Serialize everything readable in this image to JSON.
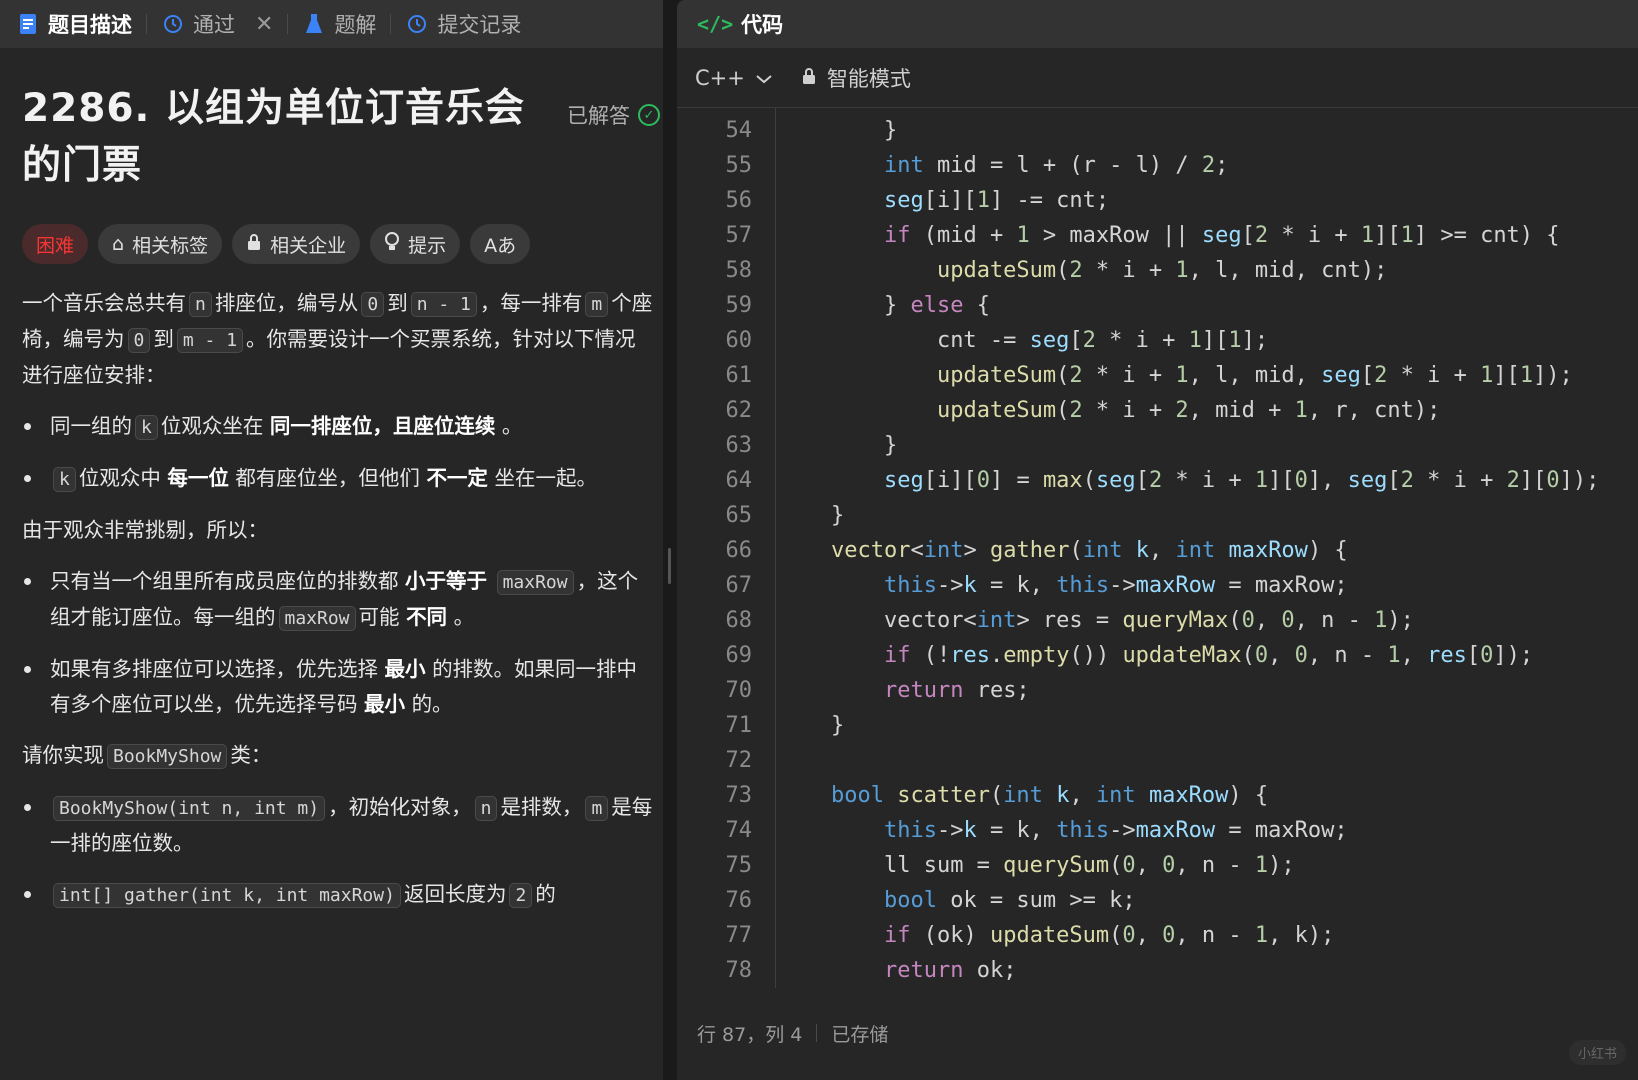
{
  "tabs": {
    "description": "题目描述",
    "passed": "通过",
    "solutions": "题解",
    "submissions": "提交记录"
  },
  "problem": {
    "title": "2286. 以组为单位订音乐会的门票",
    "solved_label": "已解答",
    "tags": {
      "difficulty": "困难",
      "related_tags": "相关标签",
      "related_companies": "相关企业",
      "hint": "提示",
      "font": "Aあ"
    }
  },
  "description": {
    "p1": [
      "一个音乐会总共有",
      "n",
      "排座位，编号从",
      "0",
      "到",
      "n - 1",
      "，每一排有",
      "m",
      "个座椅，编号为",
      "0",
      "到",
      "m - 1",
      "。你需要设计一个买票系统，针对以下情况进行座位安排："
    ],
    "b1": [
      "同一组的",
      "k",
      "位观众坐在",
      "同一排座位，且座位连续",
      "。"
    ],
    "b2": [
      "k",
      "位观众中",
      "每一位",
      "都有座位坐，但他们",
      "不一定",
      "坐在一起。"
    ],
    "p2": "由于观众非常挑剔，所以：",
    "b3": [
      "只有当一个组里所有成员座位的排数都",
      "小于等于",
      "maxRow",
      "，这个组才能订座位。每一组的",
      "maxRow",
      "可能",
      "不同",
      "。"
    ],
    "b4": [
      "如果有多排座位可以选择，优先选择",
      "最小",
      "的排数。如果同一排中有多个座位可以坐，优先选择号码",
      "最小",
      "的。"
    ],
    "p3": [
      "请你实现",
      "BookMyShow",
      "类："
    ],
    "b5": [
      "BookMyShow(int n, int m)",
      "，初始化对象，",
      "n",
      "是排数，",
      "m",
      "是每一排的座位数。"
    ],
    "b6": [
      "int[] gather(int k, int maxRow)",
      "返回长度为",
      "2",
      "的"
    ]
  },
  "editor": {
    "header": "代码",
    "language": "C++",
    "mode": "智能模式",
    "lines": [
      {
        "n": "54",
        "t": [
          [
            "p",
            "    }"
          ]
        ]
      },
      {
        "n": "55",
        "t": [
          [
            "p",
            "    "
          ],
          [
            "kw",
            "int"
          ],
          [
            "p",
            " mid = l + (r - l) / "
          ],
          [
            "num",
            "2"
          ],
          [
            "p",
            ";"
          ]
        ]
      },
      {
        "n": "56",
        "t": [
          [
            "p",
            "    "
          ],
          [
            "var",
            "seg"
          ],
          [
            "p",
            "[i]["
          ],
          [
            "num",
            "1"
          ],
          [
            "p",
            "] -= cnt;"
          ]
        ]
      },
      {
        "n": "57",
        "t": [
          [
            "p",
            "    "
          ],
          [
            "ctl",
            "if"
          ],
          [
            "p",
            " (mid + "
          ],
          [
            "num",
            "1"
          ],
          [
            "p",
            " > maxRow || "
          ],
          [
            "var",
            "seg"
          ],
          [
            "p",
            "["
          ],
          [
            "num",
            "2"
          ],
          [
            "p",
            " * i + "
          ],
          [
            "num",
            "1"
          ],
          [
            "p",
            "]["
          ],
          [
            "num",
            "1"
          ],
          [
            "p",
            "] >= cnt) {"
          ]
        ]
      },
      {
        "n": "58",
        "t": [
          [
            "p",
            "        "
          ],
          [
            "fn",
            "updateSum"
          ],
          [
            "p",
            "("
          ],
          [
            "num",
            "2"
          ],
          [
            "p",
            " * i + "
          ],
          [
            "num",
            "1"
          ],
          [
            "p",
            ", l, mid, cnt);"
          ]
        ]
      },
      {
        "n": "59",
        "t": [
          [
            "p",
            "    } "
          ],
          [
            "ctl",
            "else"
          ],
          [
            "p",
            " {"
          ]
        ]
      },
      {
        "n": "60",
        "t": [
          [
            "p",
            "        cnt -= "
          ],
          [
            "var",
            "seg"
          ],
          [
            "p",
            "["
          ],
          [
            "num",
            "2"
          ],
          [
            "p",
            " * i + "
          ],
          [
            "num",
            "1"
          ],
          [
            "p",
            "]["
          ],
          [
            "num",
            "1"
          ],
          [
            "p",
            "];"
          ]
        ]
      },
      {
        "n": "61",
        "t": [
          [
            "p",
            "        "
          ],
          [
            "fn",
            "updateSum"
          ],
          [
            "p",
            "("
          ],
          [
            "num",
            "2"
          ],
          [
            "p",
            " * i + "
          ],
          [
            "num",
            "1"
          ],
          [
            "p",
            ", l, mid, "
          ],
          [
            "var",
            "seg"
          ],
          [
            "p",
            "["
          ],
          [
            "num",
            "2"
          ],
          [
            "p",
            " * i + "
          ],
          [
            "num",
            "1"
          ],
          [
            "p",
            "]["
          ],
          [
            "num",
            "1"
          ],
          [
            "p",
            "]);"
          ]
        ]
      },
      {
        "n": "62",
        "t": [
          [
            "p",
            "        "
          ],
          [
            "fn",
            "updateSum"
          ],
          [
            "p",
            "("
          ],
          [
            "num",
            "2"
          ],
          [
            "p",
            " * i + "
          ],
          [
            "num",
            "2"
          ],
          [
            "p",
            ", mid + "
          ],
          [
            "num",
            "1"
          ],
          [
            "p",
            ", r, cnt);"
          ]
        ]
      },
      {
        "n": "63",
        "t": [
          [
            "p",
            "    }"
          ]
        ]
      },
      {
        "n": "64",
        "t": [
          [
            "p",
            "    "
          ],
          [
            "var",
            "seg"
          ],
          [
            "p",
            "[i]["
          ],
          [
            "num",
            "0"
          ],
          [
            "p",
            "] = "
          ],
          [
            "fn",
            "max"
          ],
          [
            "p",
            "("
          ],
          [
            "var",
            "seg"
          ],
          [
            "p",
            "["
          ],
          [
            "num",
            "2"
          ],
          [
            "p",
            " * i + "
          ],
          [
            "num",
            "1"
          ],
          [
            "p",
            "]["
          ],
          [
            "num",
            "0"
          ],
          [
            "p",
            "], "
          ],
          [
            "var",
            "seg"
          ],
          [
            "p",
            "["
          ],
          [
            "num",
            "2"
          ],
          [
            "p",
            " * i + "
          ],
          [
            "num",
            "2"
          ],
          [
            "p",
            "]["
          ],
          [
            "num",
            "0"
          ],
          [
            "p",
            "]);"
          ]
        ]
      },
      {
        "n": "65",
        "t": [
          [
            "p",
            "}"
          ]
        ]
      },
      {
        "n": "66",
        "t": [
          [
            "fn",
            "vector"
          ],
          [
            "p",
            "<"
          ],
          [
            "kw",
            "int"
          ],
          [
            "p",
            "> "
          ],
          [
            "fn",
            "gather"
          ],
          [
            "p",
            "("
          ],
          [
            "kw",
            "int"
          ],
          [
            "p",
            " "
          ],
          [
            "var",
            "k"
          ],
          [
            "p",
            ", "
          ],
          [
            "kw",
            "int"
          ],
          [
            "p",
            " "
          ],
          [
            "var",
            "maxRow"
          ],
          [
            "p",
            ") {"
          ]
        ]
      },
      {
        "n": "67",
        "t": [
          [
            "p",
            "    "
          ],
          [
            "kw",
            "this"
          ],
          [
            "p",
            "->"
          ],
          [
            "var",
            "k"
          ],
          [
            "p",
            " = k, "
          ],
          [
            "kw",
            "this"
          ],
          [
            "p",
            "->"
          ],
          [
            "var",
            "maxRow"
          ],
          [
            "p",
            " = maxRow;"
          ]
        ]
      },
      {
        "n": "68",
        "t": [
          [
            "p",
            "    vector<"
          ],
          [
            "kw",
            "int"
          ],
          [
            "p",
            "> res = "
          ],
          [
            "fn",
            "queryMax"
          ],
          [
            "p",
            "("
          ],
          [
            "num",
            "0"
          ],
          [
            "p",
            ", "
          ],
          [
            "num",
            "0"
          ],
          [
            "p",
            ", n - "
          ],
          [
            "num",
            "1"
          ],
          [
            "p",
            ");"
          ]
        ]
      },
      {
        "n": "69",
        "t": [
          [
            "p",
            "    "
          ],
          [
            "ctl",
            "if"
          ],
          [
            "p",
            " (!"
          ],
          [
            "var",
            "res"
          ],
          [
            "p",
            "."
          ],
          [
            "fn",
            "empty"
          ],
          [
            "p",
            "()) "
          ],
          [
            "fn",
            "updateMax"
          ],
          [
            "p",
            "("
          ],
          [
            "num",
            "0"
          ],
          [
            "p",
            ", "
          ],
          [
            "num",
            "0"
          ],
          [
            "p",
            ", n - "
          ],
          [
            "num",
            "1"
          ],
          [
            "p",
            ", "
          ],
          [
            "var",
            "res"
          ],
          [
            "p",
            "["
          ],
          [
            "num",
            "0"
          ],
          [
            "p",
            "]);"
          ]
        ]
      },
      {
        "n": "70",
        "t": [
          [
            "p",
            "    "
          ],
          [
            "ctl",
            "return"
          ],
          [
            "p",
            " res;"
          ]
        ]
      },
      {
        "n": "71",
        "t": [
          [
            "p",
            "}"
          ]
        ]
      },
      {
        "n": "72",
        "t": [
          [
            "p",
            ""
          ]
        ]
      },
      {
        "n": "73",
        "t": [
          [
            "kw",
            "bool"
          ],
          [
            "p",
            " "
          ],
          [
            "fn",
            "scatter"
          ],
          [
            "p",
            "("
          ],
          [
            "kw",
            "int"
          ],
          [
            "p",
            " "
          ],
          [
            "var",
            "k"
          ],
          [
            "p",
            ", "
          ],
          [
            "kw",
            "int"
          ],
          [
            "p",
            " "
          ],
          [
            "var",
            "maxRow"
          ],
          [
            "p",
            ") {"
          ]
        ]
      },
      {
        "n": "74",
        "t": [
          [
            "p",
            "    "
          ],
          [
            "kw",
            "this"
          ],
          [
            "p",
            "->"
          ],
          [
            "var",
            "k"
          ],
          [
            "p",
            " = k, "
          ],
          [
            "kw",
            "this"
          ],
          [
            "p",
            "->"
          ],
          [
            "var",
            "maxRow"
          ],
          [
            "p",
            " = maxRow;"
          ]
        ]
      },
      {
        "n": "75",
        "t": [
          [
            "p",
            "    ll sum = "
          ],
          [
            "fn",
            "querySum"
          ],
          [
            "p",
            "("
          ],
          [
            "num",
            "0"
          ],
          [
            "p",
            ", "
          ],
          [
            "num",
            "0"
          ],
          [
            "p",
            ", n - "
          ],
          [
            "num",
            "1"
          ],
          [
            "p",
            ");"
          ]
        ]
      },
      {
        "n": "76",
        "t": [
          [
            "p",
            "    "
          ],
          [
            "kw",
            "bool"
          ],
          [
            "p",
            " ok = sum >= k;"
          ]
        ]
      },
      {
        "n": "77",
        "t": [
          [
            "p",
            "    "
          ],
          [
            "ctl",
            "if"
          ],
          [
            "p",
            " (ok) "
          ],
          [
            "fn",
            "updateSum"
          ],
          [
            "p",
            "("
          ],
          [
            "num",
            "0"
          ],
          [
            "p",
            ", "
          ],
          [
            "num",
            "0"
          ],
          [
            "p",
            ", n - "
          ],
          [
            "num",
            "1"
          ],
          [
            "p",
            ", k);"
          ]
        ]
      },
      {
        "n": "78",
        "t": [
          [
            "p",
            "    "
          ],
          [
            "ctl",
            "return"
          ],
          [
            "p",
            " ok;"
          ]
        ]
      }
    ]
  },
  "status": {
    "position": "行 87，列 4",
    "saved": "已存储"
  },
  "watermark": "小红书",
  "colors": {
    "accent_green": "#2cbb5d",
    "hard_red": "#f63636",
    "keyword_blue": "#569cd6",
    "control_purple": "#c586c0",
    "function_yellow": "#dcdcaa",
    "number_green": "#b5cea8",
    "variable_cyan": "#9cdcfe"
  }
}
